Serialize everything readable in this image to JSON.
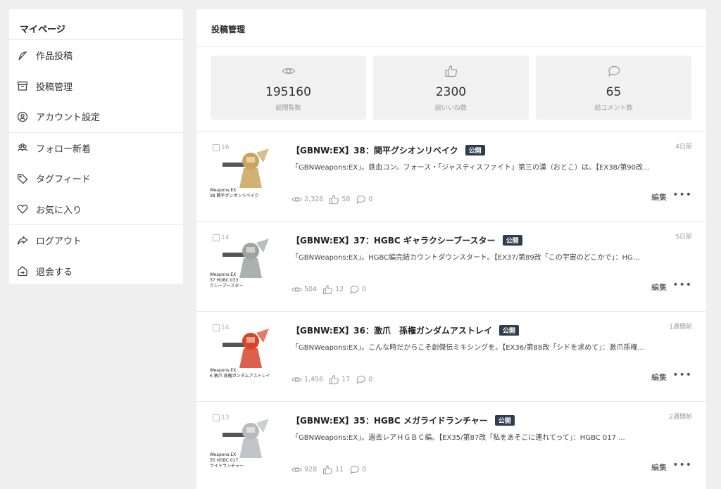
{
  "sidebar": {
    "title": "マイページ",
    "groups": [
      [
        {
          "label": "作品投稿",
          "icon": "feather-icon"
        },
        {
          "label": "投稿管理",
          "icon": "archive-icon"
        },
        {
          "label": "アカウント設定",
          "icon": "account-icon"
        }
      ],
      [
        {
          "label": "フォロー新着",
          "icon": "users-icon"
        },
        {
          "label": "タグフィード",
          "icon": "tag-icon"
        },
        {
          "label": "お気に入り",
          "icon": "heart-icon"
        }
      ],
      [
        {
          "label": "ログアウト",
          "icon": "share-arrow-icon"
        },
        {
          "label": "退会する",
          "icon": "home-exit-icon"
        }
      ]
    ]
  },
  "main": {
    "title": "投稿管理",
    "stats": [
      {
        "value": "195160",
        "label": "総閲覧数",
        "icon": "eye-icon"
      },
      {
        "value": "2300",
        "label": "総いいね数",
        "icon": "thumbs-up-icon"
      },
      {
        "value": "65",
        "label": "総コメント数",
        "icon": "comment-icon"
      }
    ],
    "posts": [
      {
        "title": "【GBNW:EX】38：関平グシオンリベイク",
        "badge": "公開",
        "time": "4日前",
        "desc": "「GBNWeapons:EX」。鉄血コン。フォース・「ジャスティスファイト」第三の漢（おとこ）は。【EX38/第90改...",
        "views": "2,328",
        "likes": "58",
        "comments": "0",
        "edit": "編集",
        "image_count": "16",
        "caption1": "Weapons:EX",
        "caption2": "38 関平グシオンリベイク",
        "color": "#c9a45a"
      },
      {
        "title": "【GBNW:EX】37：HGBC ギャラクシーブースター",
        "badge": "公開",
        "time": "5日前",
        "desc": "「GBNWeapons:EX」。HGBC編完結カウントダウンスタート。【EX37/第89改「この宇宙のどこかで」：HG...",
        "views": "504",
        "likes": "12",
        "comments": "0",
        "edit": "編集",
        "image_count": "14",
        "caption1": "Weapons:EX",
        "caption2": "37 HGBC 033",
        "caption3": "クシーブースター",
        "color": "#9aa5a0"
      },
      {
        "title": "【GBNW:EX】36：激爪　孫権ガンダムアストレイ",
        "badge": "公開",
        "time": "1週間前",
        "desc": "「GBNWeapons:EX」。こんな時だからこそ創傑伝ミキシングを。【EX36/第88改「シドを求めて」：激爪孫権...",
        "views": "1,456",
        "likes": "17",
        "comments": "0",
        "edit": "編集",
        "image_count": "14",
        "caption1": "Weapons:EX",
        "caption2": "6 激爪 孫権ガンダムアストレイ",
        "color": "#d6452a"
      },
      {
        "title": "【GBNW:EX】35：HGBC メガライドランチャー",
        "badge": "公開",
        "time": "2週間前",
        "desc": "「GBNWeapons:EX」。過去レアＨＧＢＣ編。【EX35/第87改「私をあそこに連れてって」：HGBC 017 ...",
        "views": "928",
        "likes": "11",
        "comments": "0",
        "edit": "編集",
        "image_count": "13",
        "caption1": "Weapons:EX",
        "caption2": "35 HGBC 017",
        "caption3": "ライドランチャー",
        "color": "#b7bbbd"
      }
    ]
  }
}
